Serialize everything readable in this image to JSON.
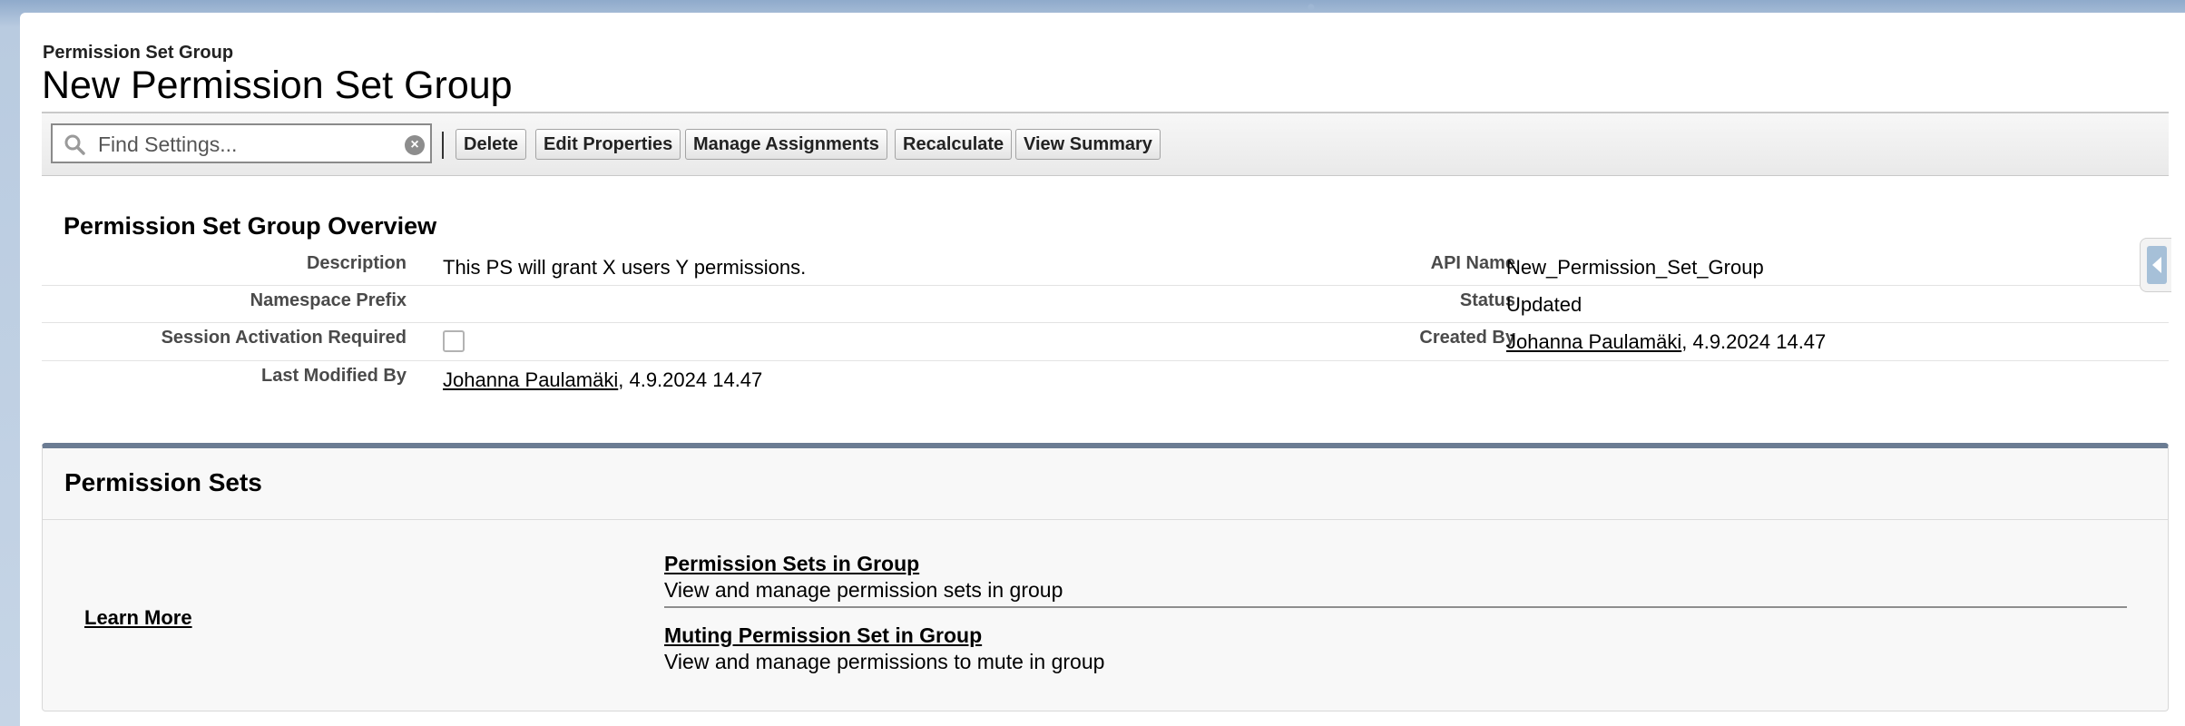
{
  "header": {
    "eyebrow": "Permission Set Group",
    "title": "New Permission Set Group"
  },
  "toolbar": {
    "search_placeholder": "Find Settings...",
    "buttons": {
      "delete": "Delete",
      "edit_properties": "Edit Properties",
      "manage_assignments": "Manage Assignments",
      "recalculate": "Recalculate",
      "view_summary": "View Summary"
    }
  },
  "overview": {
    "title": "Permission Set Group Overview",
    "fields": {
      "description_label": "Description",
      "description_value": "This PS will grant X users Y permissions.",
      "api_name_label": "API Name",
      "api_name_value": "New_Permission_Set_Group",
      "namespace_label": "Namespace Prefix",
      "namespace_value": "",
      "status_label": "Status",
      "status_value": "Updated",
      "session_label": "Session Activation Required",
      "session_checked": false,
      "created_by_label": "Created By",
      "created_by_user": "Johanna Paulamäki",
      "created_by_date": ", 4.9.2024 14.47",
      "last_modified_label": "Last Modified By",
      "last_modified_user": "Johanna Paulamäki",
      "last_modified_date": ", 4.9.2024 14.47"
    }
  },
  "permission_sets": {
    "title": "Permission Sets",
    "learn_more": "Learn More",
    "links": [
      {
        "label": "Permission Sets in Group",
        "description": "View and manage permission sets in group"
      },
      {
        "label": "Muting Permission Set in Group",
        "description": "View and manage permissions to mute in group"
      }
    ]
  },
  "colors": {
    "panel_accent": "#6b7c93",
    "page_background": "#b9cbe0"
  },
  "icons": {
    "search": "magnifier-icon",
    "clear": "clear-x-icon",
    "side_tab": "collapse-arrow-icon"
  }
}
